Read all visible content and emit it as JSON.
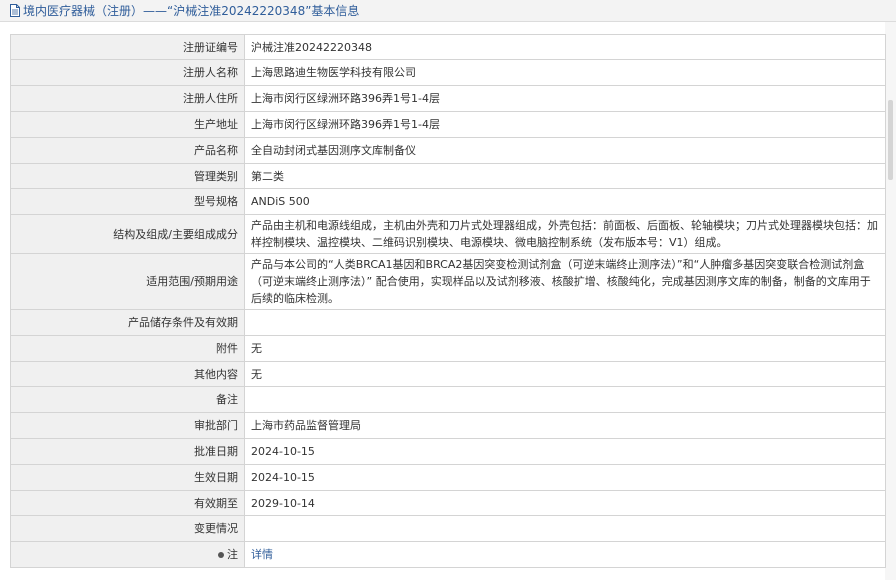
{
  "header": {
    "breadcrumb": "境内医疗器械（注册）——“沪械注准20242220348”基本信息"
  },
  "rows": [
    {
      "label": "注册证编号",
      "value": "沪械注准20242220348"
    },
    {
      "label": "注册人名称",
      "value": "上海思路迪生物医学科技有限公司"
    },
    {
      "label": "注册人住所",
      "value": "上海市闵行区绿洲环路396弄1号1-4层"
    },
    {
      "label": "生产地址",
      "value": "上海市闵行区绿洲环路396弄1号1-4层"
    },
    {
      "label": "产品名称",
      "value": "全自动封闭式基因测序文库制备仪"
    },
    {
      "label": "管理类别",
      "value": "第二类"
    },
    {
      "label": "型号规格",
      "value": "ANDiS 500"
    },
    {
      "label": "结构及组成/主要组成成分",
      "value": "产品由主机和电源线组成，主机由外壳和刀片式处理器组成，外壳包括：前面板、后面板、轮轴模块；刀片式处理器模块包括：加样控制模块、温控模块、二维码识别模块、电源模块、微电脑控制系统（发布版本号：V1）组成。"
    },
    {
      "label": "适用范围/预期用途",
      "value": "产品与本公司的“人类BRCA1基因和BRCA2基因突变检测试剂盒（可逆末端终止测序法）”和“人肿瘤多基因突变联合检测试剂盒（可逆末端终止测序法）” 配合使用，实现样品以及试剂移液、核酸扩增、核酸纯化，完成基因测序文库的制备，制备的文库用于后续的临床检测。"
    },
    {
      "label": "产品储存条件及有效期",
      "value": ""
    },
    {
      "label": "附件",
      "value": "无"
    },
    {
      "label": "其他内容",
      "value": "无"
    },
    {
      "label": "备注",
      "value": ""
    },
    {
      "label": "审批部门",
      "value": "上海市药品监督管理局"
    },
    {
      "label": "批准日期",
      "value": "2024-10-15"
    },
    {
      "label": "生效日期",
      "value": "2024-10-15"
    },
    {
      "label": "有效期至",
      "value": "2029-10-14"
    },
    {
      "label": "变更情况",
      "value": ""
    },
    {
      "label": "注",
      "value": "详情"
    }
  ]
}
